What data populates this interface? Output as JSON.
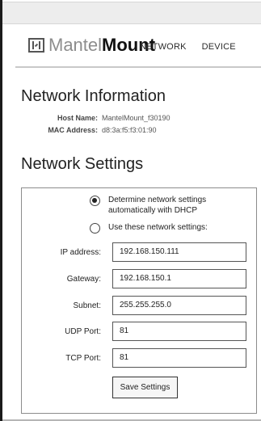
{
  "logo": {
    "light": "Mantel",
    "bold": "Mount",
    "icon": "mantelmount-logo-icon"
  },
  "nav": {
    "items": [
      {
        "label": "NETWORK"
      },
      {
        "label": "DEVICE"
      }
    ]
  },
  "network_information": {
    "title": "Network Information",
    "host_name_label": "Host Name:",
    "host_name": "MantelMount_f30190",
    "mac_address_label": "MAC Address:",
    "mac_address": "d8:3a:f5:f3:01:90"
  },
  "network_settings": {
    "title": "Network Settings",
    "options": [
      {
        "label": "Determine network settings automatically with DHCP",
        "selected": true
      },
      {
        "label": "Use these network settings:",
        "selected": false
      }
    ],
    "fields": [
      {
        "label": "IP address:",
        "value": "192.168.150.111"
      },
      {
        "label": "Gateway:",
        "value": "192.168.150.1"
      },
      {
        "label": "Subnet:",
        "value": "255.255.255.0"
      },
      {
        "label": "UDP Port:",
        "value": "81"
      },
      {
        "label": "TCP Port:",
        "value": "81"
      }
    ],
    "save_label": "Save Settings"
  },
  "colors": {
    "text": "#222222",
    "logo_gray": "#8d8d8d",
    "border": "#555555",
    "background": "#ffffff"
  }
}
